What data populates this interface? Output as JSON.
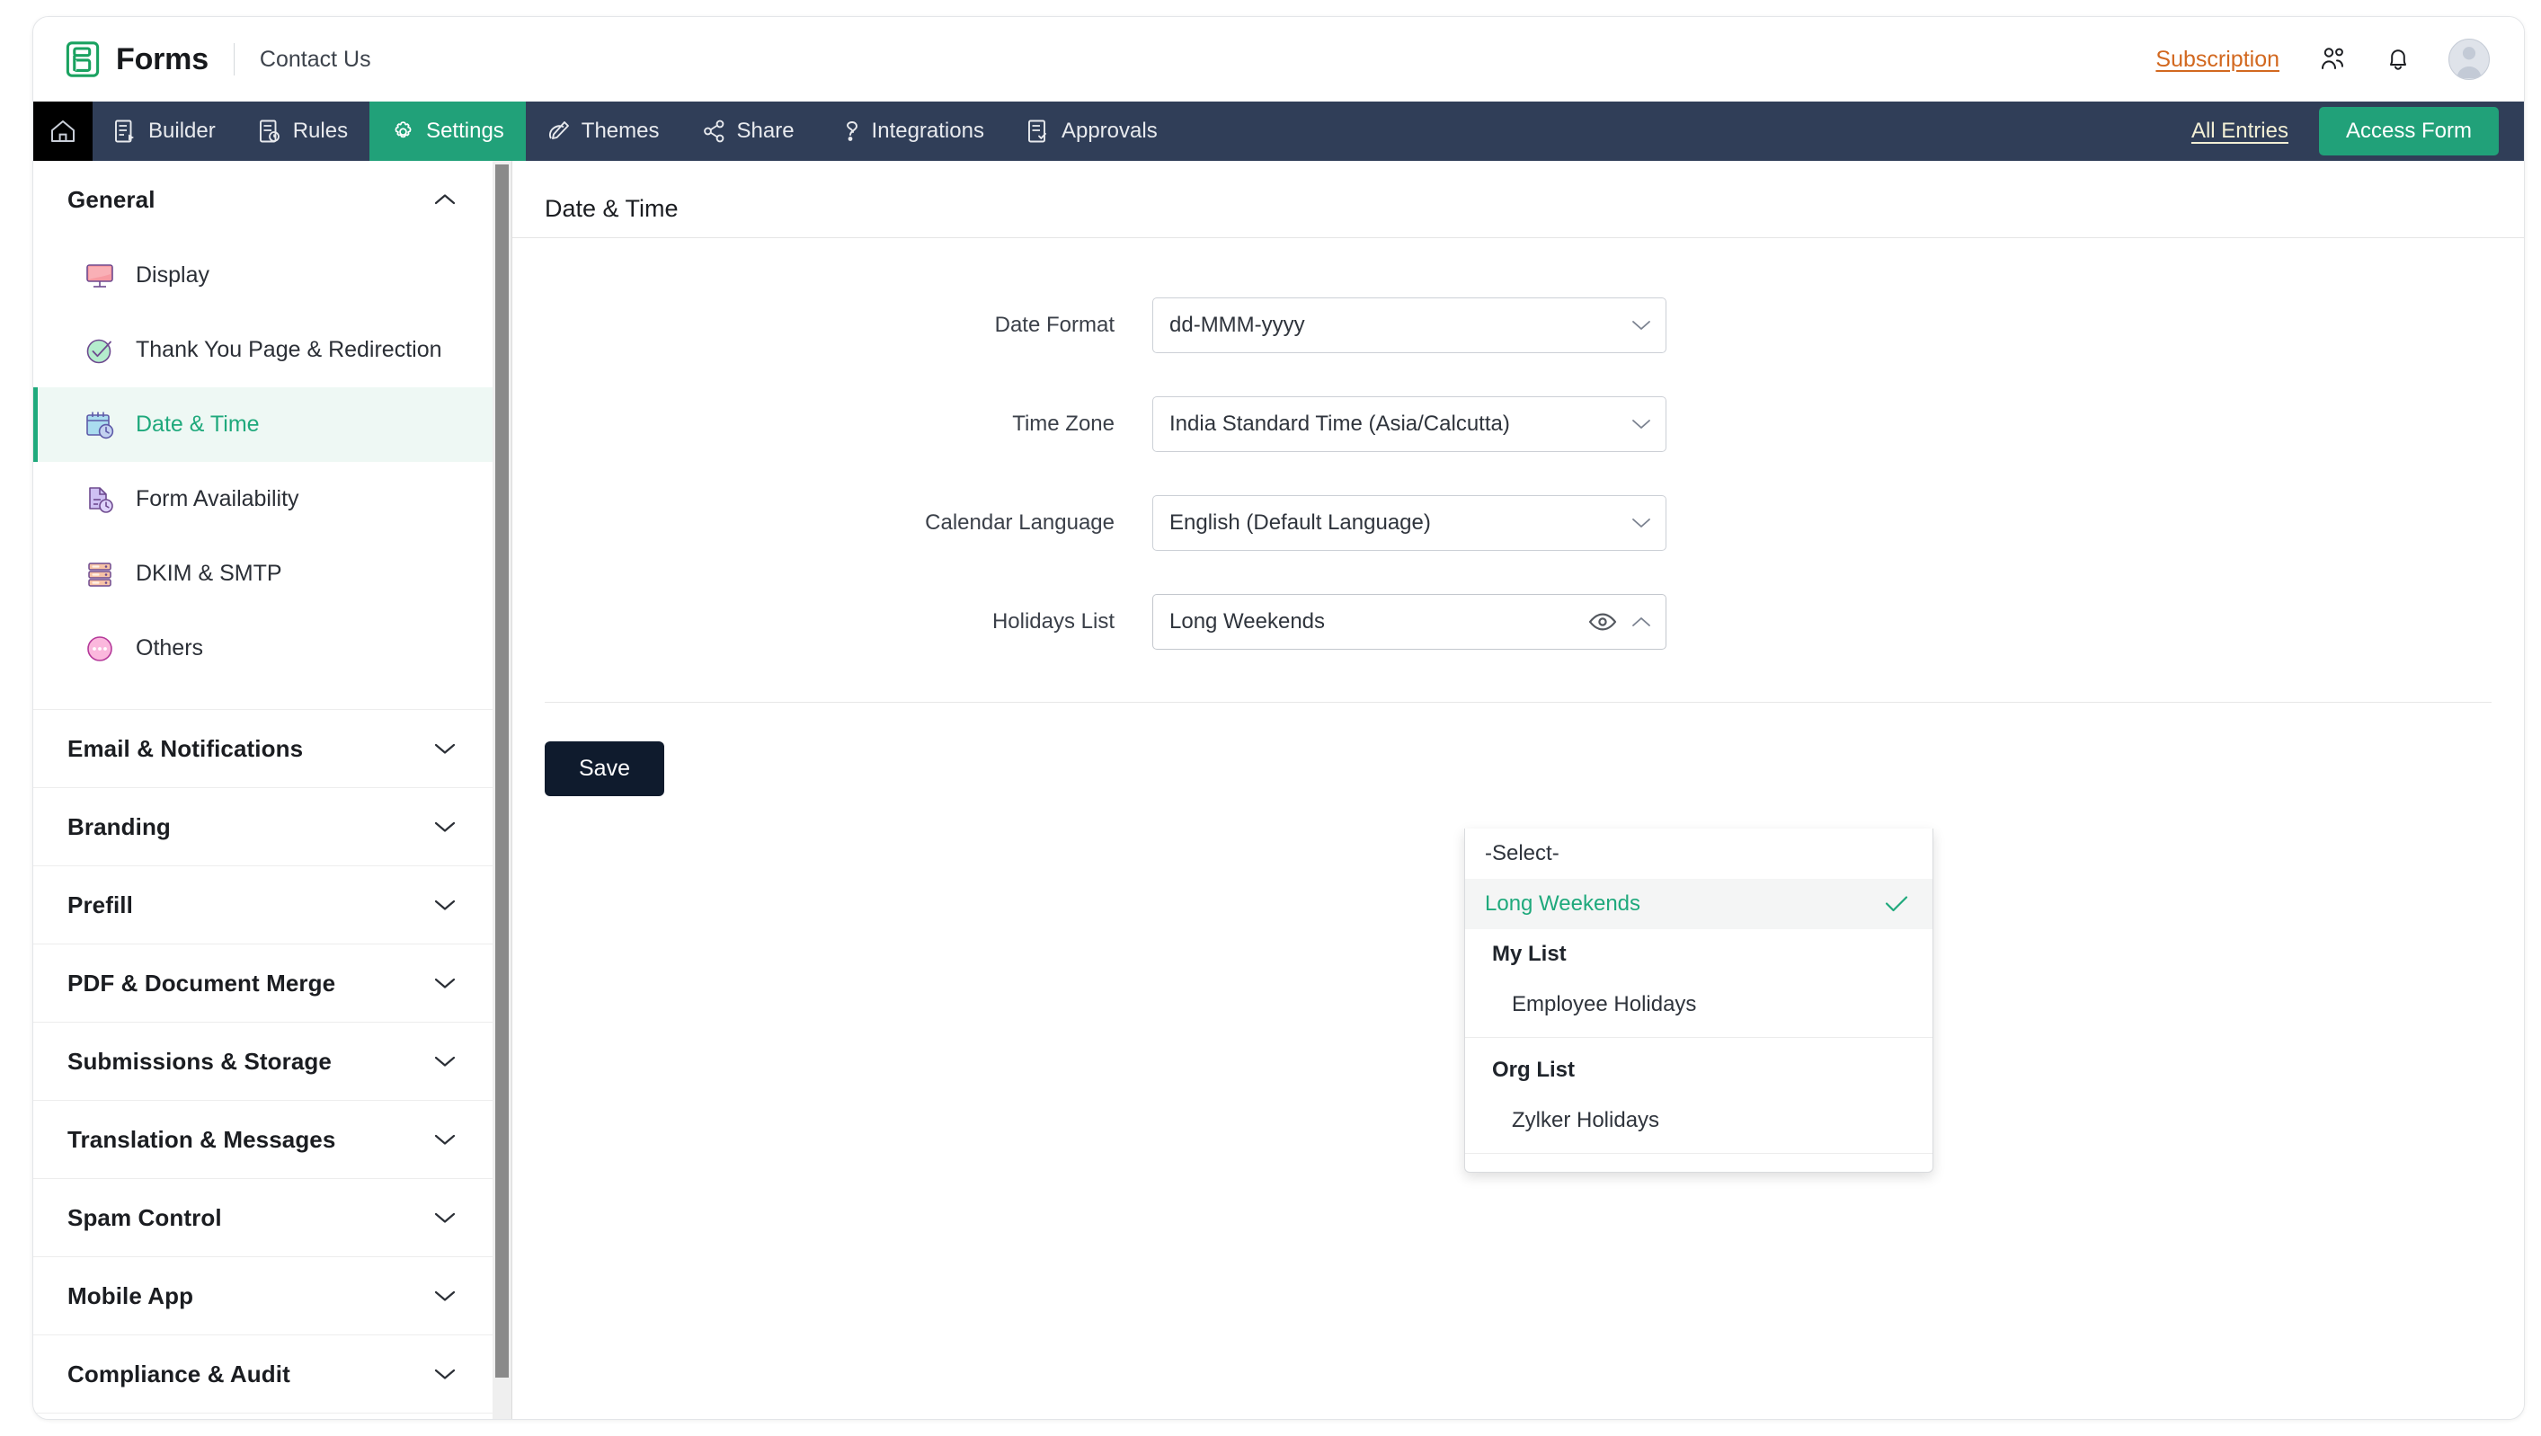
{
  "app": {
    "brand_name": "Forms",
    "contact_link": "Contact Us",
    "subscription_link": "Subscription"
  },
  "nav": {
    "items": [
      {
        "label": "Builder",
        "icon": "builder-icon",
        "active": false
      },
      {
        "label": "Rules",
        "icon": "rules-icon",
        "active": false
      },
      {
        "label": "Settings",
        "icon": "gear-icon",
        "active": true
      },
      {
        "label": "Themes",
        "icon": "themes-icon",
        "active": false
      },
      {
        "label": "Share",
        "icon": "share-icon",
        "active": false
      },
      {
        "label": "Integrations",
        "icon": "integrations-icon",
        "active": false
      },
      {
        "label": "Approvals",
        "icon": "approvals-icon",
        "active": false
      }
    ],
    "all_entries_label": "All Entries",
    "access_form_label": "Access Form",
    "accent_color": "#21a179",
    "bar_color": "#303e58"
  },
  "sidebar": {
    "general": {
      "title": "General",
      "expanded": true,
      "items": [
        {
          "label": "Display",
          "icon": "monitor-icon",
          "active": false
        },
        {
          "label": "Thank You Page & Redirection",
          "icon": "check-circle-icon",
          "active": false
        },
        {
          "label": "Date & Time",
          "icon": "calendar-clock-icon",
          "active": true
        },
        {
          "label": "Form Availability",
          "icon": "document-clock-icon",
          "active": false
        },
        {
          "label": "DKIM & SMTP",
          "icon": "server-icon",
          "active": false
        },
        {
          "label": "Others",
          "icon": "ellipsis-circle-icon",
          "active": false
        }
      ]
    },
    "sections": [
      {
        "label": "Email & Notifications",
        "expanded": false
      },
      {
        "label": "Branding",
        "expanded": false
      },
      {
        "label": "Prefill",
        "expanded": false
      },
      {
        "label": "PDF & Document Merge",
        "expanded": false
      },
      {
        "label": "Submissions & Storage",
        "expanded": false
      },
      {
        "label": "Translation & Messages",
        "expanded": false
      },
      {
        "label": "Spam Control",
        "expanded": false
      },
      {
        "label": "Mobile App",
        "expanded": false
      },
      {
        "label": "Compliance & Audit",
        "expanded": false
      }
    ]
  },
  "main": {
    "title": "Date & Time",
    "fields": {
      "date_format": {
        "label": "Date Format",
        "value": "dd-MMM-yyyy"
      },
      "time_zone": {
        "label": "Time Zone",
        "value": "India Standard Time   (Asia/Calcutta)"
      },
      "calendar_language": {
        "label": "Calendar Language",
        "value": "English (Default Language)"
      },
      "holidays_list": {
        "label": "Holidays List",
        "value": "Long Weekends"
      }
    },
    "save_label": "Save"
  },
  "holidays_dropdown": {
    "open": true,
    "placeholder_option": "-Select-",
    "selected_option": "Long Weekends",
    "groups": [
      {
        "label": "My List",
        "items": [
          "Employee Holidays"
        ]
      },
      {
        "label": "Org List",
        "items": [
          "Zylker Holidays"
        ]
      }
    ],
    "selected_color": "#1fa97c"
  }
}
